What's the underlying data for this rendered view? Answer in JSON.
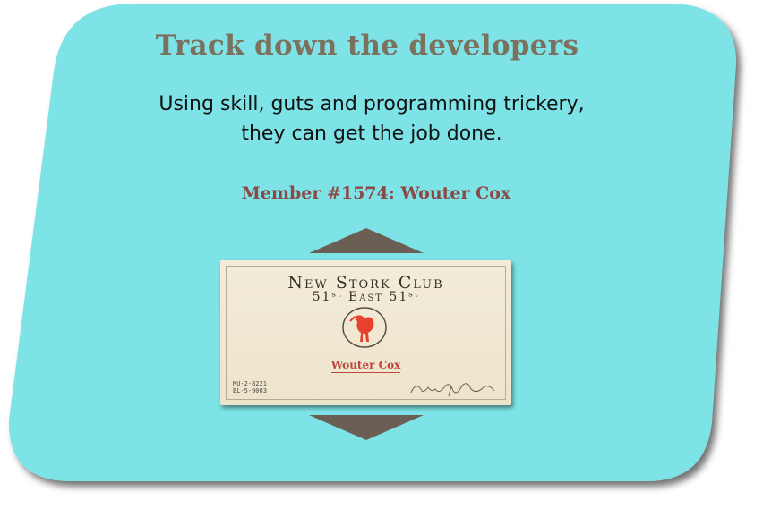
{
  "heading": "Track down the developers",
  "tagline": {
    "line1": "Using skill, guts and programming trickery,",
    "line2": "they can get the job done."
  },
  "member_caption": "Member #1574: Wouter Cox",
  "card": {
    "club_name": "New Stork Club",
    "address": "51ˢᵗ East 51ˢᵗ",
    "member_name": "Wouter Cox",
    "phone_1": "MU-2-8221",
    "phone_2": "EL-5-9003",
    "signature": "Rotert Henley"
  },
  "icons": {
    "up": "arrow-up-icon",
    "down": "arrow-down-icon",
    "logo": "stork-logo-icon"
  },
  "colors": {
    "panel": "#7ee3e6",
    "heading": "#7b715e",
    "member": "#8b4a47",
    "arrow": "#6b5f55",
    "stork": "#e8422e"
  }
}
